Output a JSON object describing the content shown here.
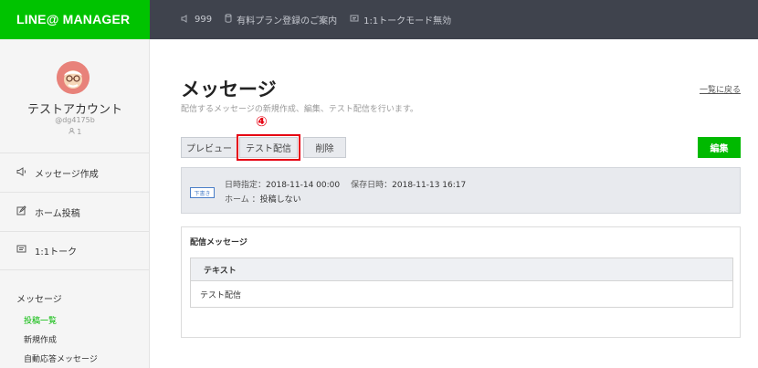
{
  "brand": {
    "logo_text": "LINE@ MANAGER",
    "color": "#00c300"
  },
  "topbar": {
    "items": [
      {
        "icon": "speaker-icon",
        "text": "999"
      },
      {
        "icon": "stack-icon",
        "text": "有料プラン登録のご案内"
      },
      {
        "icon": "chat-icon",
        "text": "1:1トークモード無効"
      }
    ]
  },
  "sidebar": {
    "account_name": "テストアカウント",
    "account_id": "@dg4175b",
    "friend_count": "1",
    "menu": [
      {
        "icon": "megaphone-icon",
        "label": "メッセージ作成"
      },
      {
        "icon": "edit-icon",
        "label": "ホーム投稿"
      },
      {
        "icon": "chat-icon",
        "label": "1:1トーク"
      }
    ],
    "section_title": "メッセージ",
    "sub_items": [
      {
        "label": "投稿一覧",
        "active": true
      },
      {
        "label": "新規作成",
        "active": false
      },
      {
        "label": "自動応答メッセージ",
        "active": false
      }
    ]
  },
  "main": {
    "title": "メッセージ",
    "description": "配信するメッセージの新規作成、編集、テスト配信を行います。",
    "back_link": "一覧に戻る",
    "marker": "④",
    "buttons": {
      "preview": "プレビュー",
      "test": "テスト配信",
      "delete": "削除",
      "edit": "編集"
    },
    "info": {
      "badge": "下書き",
      "schedule_label": "日時指定：",
      "schedule_value": "2018-11-14 00:00",
      "saved_label": "保存日時：",
      "saved_value": "2018-11-13 16:17",
      "home_label": "ホーム ：",
      "home_value": "投稿しない"
    },
    "card": {
      "title": "配信メッセージ",
      "table_header": "テキスト",
      "table_value": "テスト配信"
    }
  },
  "colors": {
    "accent": "#00b900",
    "highlight": "#e60012",
    "topbar_bg": "#3f434d"
  }
}
